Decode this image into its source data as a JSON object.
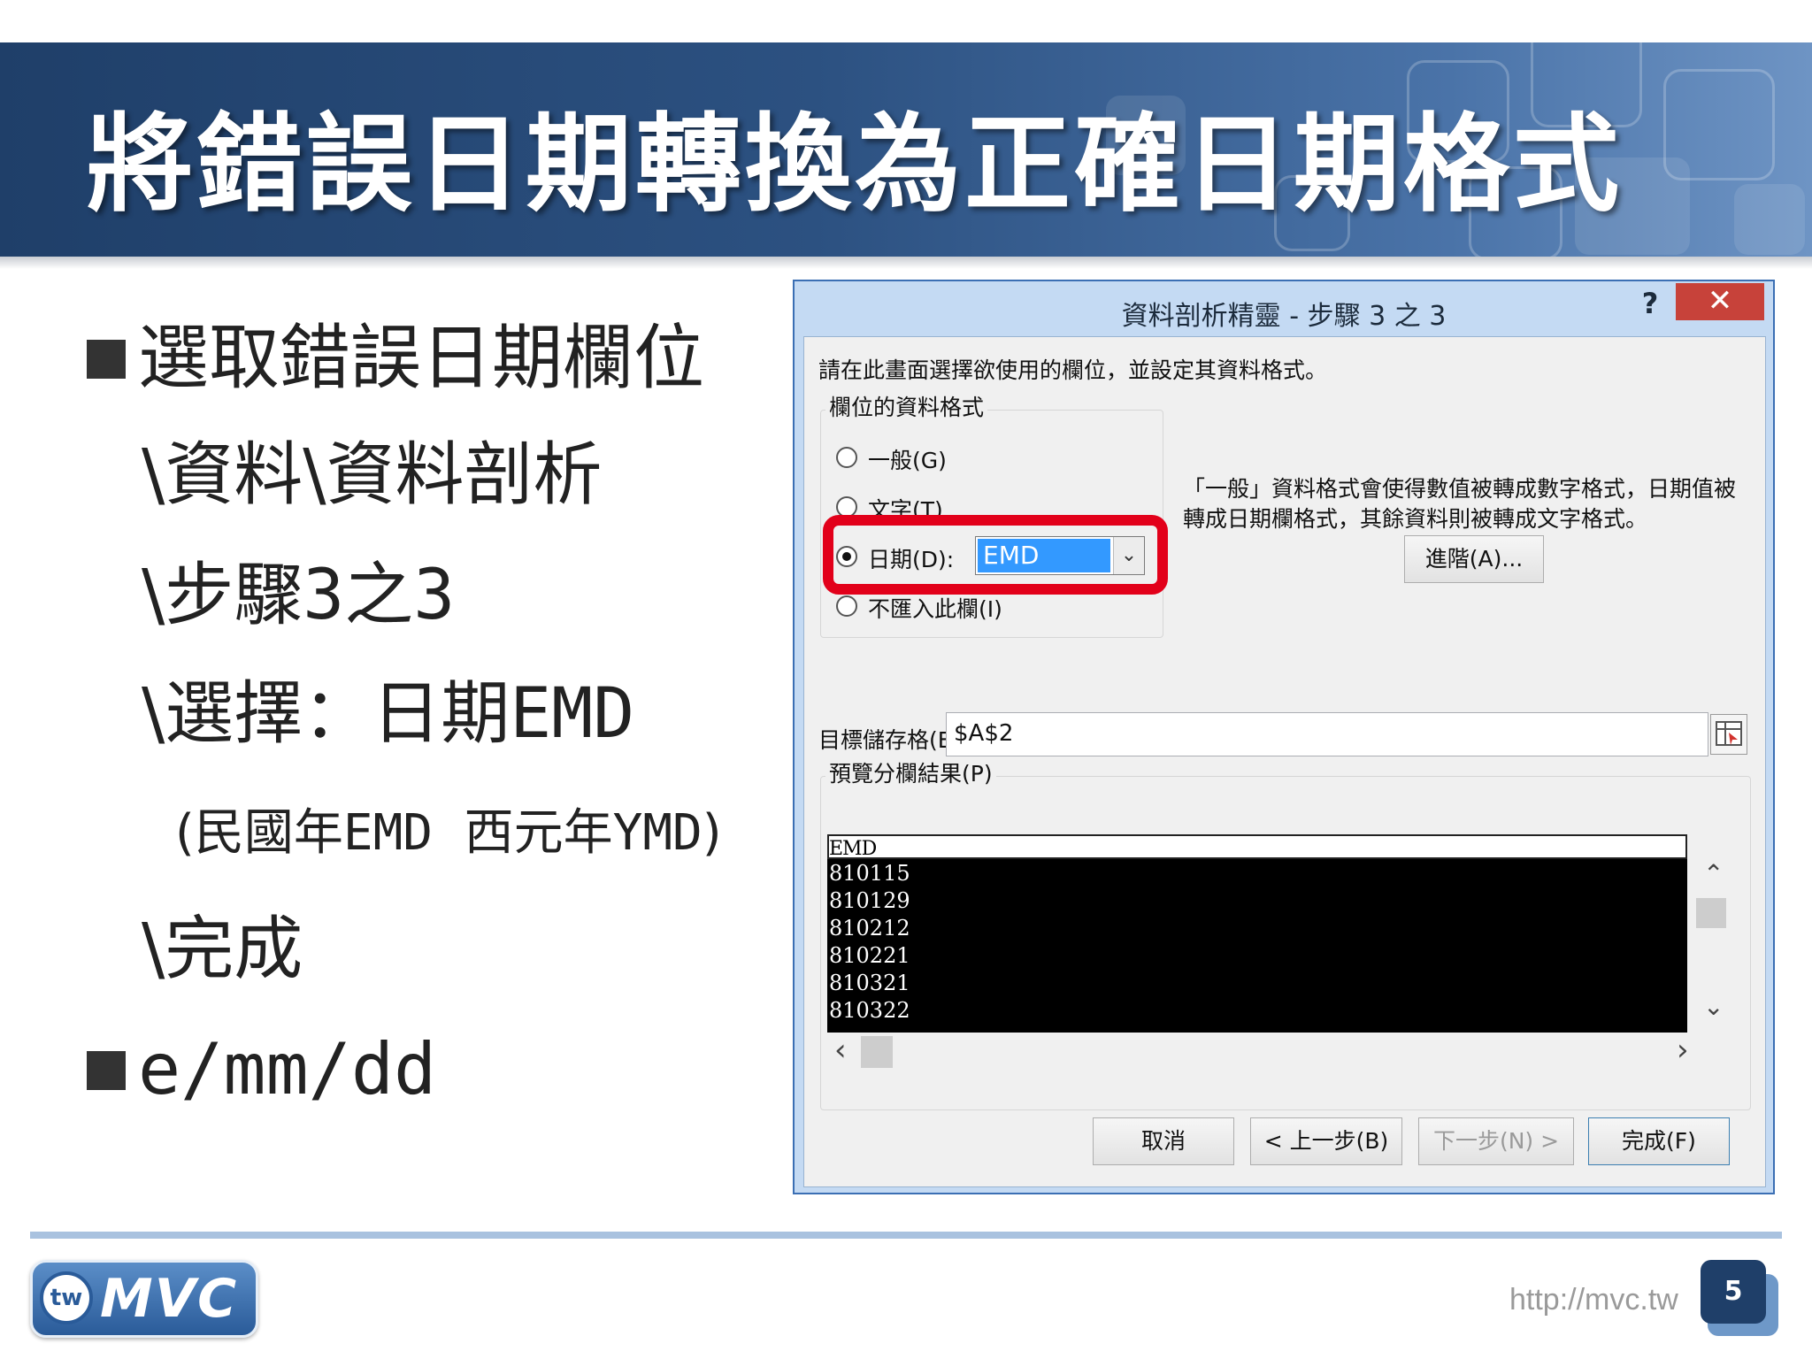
{
  "slide": {
    "title": "將錯誤日期轉換為正確日期格式",
    "bullets": [
      {
        "text": "選取錯誤日期欄位"
      },
      {
        "text": "e/mm/dd"
      }
    ],
    "sub_lines": {
      "line1": "\\資料\\資料剖析",
      "line2_prefix": "\\步驟",
      "line2_num_a": "3",
      "line2_mid": "之",
      "line2_num_b": "3",
      "line3_prefix": "\\選擇：日期",
      "line3_code": "EMD",
      "line4_open": "(民國年",
      "line4_code_a": "EMD",
      "line4_mid": "  西元年",
      "line4_code_b": "YMD",
      "line4_close": ")",
      "line5": "\\完成"
    },
    "footer": {
      "url": "http://mvc.tw",
      "page_number": "5",
      "logo_circle": "tw",
      "logo_text": "MVC"
    }
  },
  "dialog": {
    "title": "資料剖析精靈 - 步驟 3 之 3",
    "help": "?",
    "close": "✕",
    "instruction": "請在此畫面選擇欲使用的欄位，並設定其資料格式。",
    "format_group_label": "欄位的資料格式",
    "radios": [
      {
        "label": "一般(G)",
        "selected": false
      },
      {
        "label": "文字(T)",
        "selected": false
      },
      {
        "label": "日期(D):",
        "selected": true
      },
      {
        "label": "不匯入此欄(I)",
        "selected": false
      }
    ],
    "date_format_value": "EMD",
    "combo_arrow": "⌄",
    "description_line1": "「一般」資料格式會使得數值被轉成數字格式，日期值被",
    "description_line2": "轉成日期欄格式，其餘資料則被轉成文字格式。",
    "advanced_button": "進階(A)...",
    "destination_label": "目標儲存格(E):",
    "destination_value": "$A$2",
    "preview_label": "預覽分欄結果(P)",
    "preview_header": "EMD",
    "preview_rows": [
      "810115",
      "810129",
      "810212",
      "810221",
      "810321",
      "810322"
    ],
    "scroll_up": "⌃",
    "scroll_down": "⌄",
    "scroll_left": "‹",
    "scroll_right": "›",
    "buttons": {
      "cancel": "取消",
      "back": "< 上一步(B)",
      "next": "下一步(N) >",
      "finish": "完成(F)"
    }
  }
}
